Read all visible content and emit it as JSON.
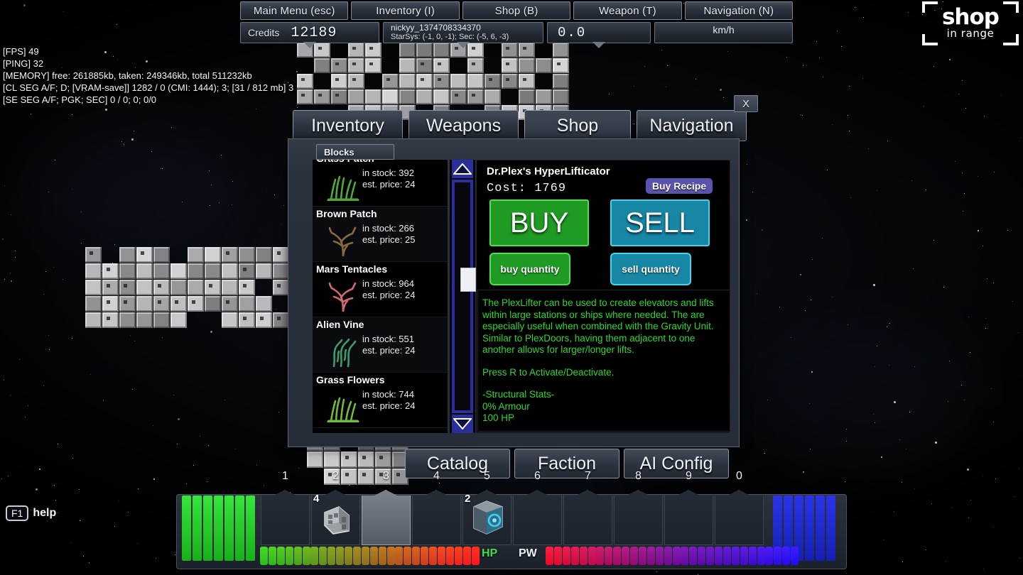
{
  "hud": {
    "top_menu": [
      {
        "label": "Main Menu (esc)",
        "name": "main-menu"
      },
      {
        "label": "Inventory (I)",
        "name": "inventory"
      },
      {
        "label": "Shop (B)",
        "name": "shop"
      },
      {
        "label": "Weapon (T)",
        "name": "weapon"
      },
      {
        "label": "Navigation (N)",
        "name": "navigation"
      }
    ],
    "credits_label": "Credits",
    "credits_value": "12189",
    "player_name": "nickyy_1374708334370",
    "player_coords": "StarSys: (-1, 0, -1); Sec: (-5, 6, -3)",
    "speed_value": "0.0",
    "speed_unit": "km/h",
    "shop_range_line1": "shop",
    "shop_range_line2": "in range",
    "help_key": "F1",
    "help_label": "help"
  },
  "debug": {
    "lines": [
      "[FPS] 49",
      "[PING] 32",
      "[MEMORY] free: 261885kb, taken: 249346kb, total 511232kb",
      "[CL SEG A/F; D; [VRAM-save]] 1282 / 0 (CMI: 1444); 3; [31 / 812 mb] 3",
      "[SE SEG A/F; PGK; SEC] 0 / 0; 0; 0/0"
    ]
  },
  "window": {
    "tabs": [
      {
        "label": "Inventory",
        "active": false
      },
      {
        "label": "Weapons",
        "active": false
      },
      {
        "label": "Shop",
        "active": true
      },
      {
        "label": "Navigation",
        "active": false
      }
    ],
    "close_label": "X",
    "sub_tab": "Blocks",
    "bottom_buttons": [
      {
        "label": "Catalog"
      },
      {
        "label": "Faction"
      },
      {
        "label": "AI Config"
      }
    ]
  },
  "item_list": {
    "stock_prefix": "in stock: ",
    "price_prefix": "est. price: ",
    "items": [
      {
        "name": "Grass Patch",
        "stock": "in stock: 392",
        "price": "est. price: 24",
        "color": "#4fa83a",
        "shape": "grass"
      },
      {
        "name": "Brown Patch",
        "stock": "in stock: 266",
        "price": "est. price: 25",
        "color": "#8a6a3c",
        "shape": "coral"
      },
      {
        "name": "Mars Tentacles",
        "stock": "in stock: 964",
        "price": "est. price: 24",
        "color": "#d06a72",
        "shape": "coral"
      },
      {
        "name": "Alien Vine",
        "stock": "in stock: 551",
        "price": "est. price: 24",
        "color": "#3f9b6c",
        "shape": "vine"
      },
      {
        "name": "Grass Flowers",
        "stock": "in stock: 744",
        "price": "est. price: 24",
        "color": "#6fbb3a",
        "shape": "grass"
      }
    ]
  },
  "detail": {
    "item_name": "Dr.Plex's HyperLifticator",
    "cost_label": "Cost:  1769",
    "recipe_button": "Buy Recipe",
    "buy_button": "BUY",
    "sell_button": "SELL",
    "buy_qty_button": "buy quantity",
    "sell_qty_button": "sell quantity",
    "description": [
      "The PlexLifter can be used to create elevators and lifts within large stations or ships where needed. The are especially useful when combined with the Gravity Unit. Similar to PlexDoors, having them adjacent to one another allows for larger/longer lifts.",
      "Press R to Activate/Deactivate.",
      "-Structural Stats-"
    ],
    "stats": [
      "0% Armour",
      "100 HP"
    ]
  },
  "hotbar": {
    "slots": [
      {
        "num": "1",
        "qty": "",
        "item": "none"
      },
      {
        "num": "2",
        "qty": "4",
        "item": "hull-block"
      },
      {
        "num": "3",
        "qty": "",
        "item": "none",
        "selected": true
      },
      {
        "num": "4",
        "qty": "",
        "item": "none"
      },
      {
        "num": "5",
        "qty": "2",
        "item": "plex-lifter"
      },
      {
        "num": "6",
        "qty": "",
        "item": "none"
      },
      {
        "num": "7",
        "qty": "",
        "item": "none"
      },
      {
        "num": "8",
        "qty": "",
        "item": "none"
      },
      {
        "num": "9",
        "qty": "",
        "item": "none"
      },
      {
        "num": "0",
        "qty": "",
        "item": "none"
      }
    ],
    "hp_label": "HP",
    "pw_label": "PW"
  },
  "colors": {
    "buy_green": "#1f9b23",
    "buy_green_border": "#4fe04f",
    "sell_teal": "#1787a5",
    "sell_teal_border": "#3fd8e8",
    "recipe_purple": "#5a52ad",
    "description_green": "#2bd82b",
    "panel_bg": "#2a313c",
    "scroll_blue": "#2b2f9c"
  }
}
